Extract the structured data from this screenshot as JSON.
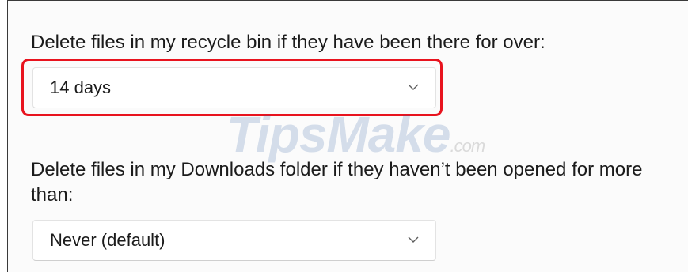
{
  "recycle_bin": {
    "label": "Delete files in my recycle bin if they have been there for over:",
    "selected_value": "14 days"
  },
  "downloads": {
    "label": "Delete files in my Downloads folder if they haven’t been opened for more than:",
    "selected_value": "Never (default)"
  },
  "highlight_color": "#e8131e",
  "watermark": {
    "text": "TipsMake",
    "suffix": ".com"
  },
  "icons": {
    "dropdown": "chevron-down-icon"
  }
}
